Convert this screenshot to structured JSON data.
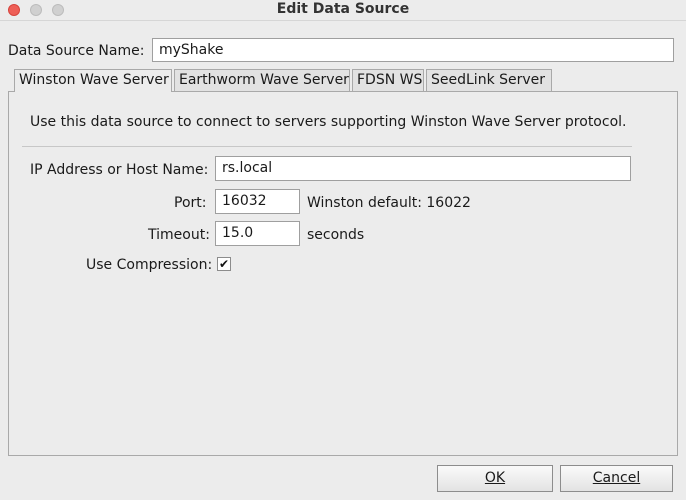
{
  "window": {
    "title": "Edit Data Source"
  },
  "data_source": {
    "name_label": "Data Source Name:",
    "name_value": "myShake"
  },
  "tabs": [
    {
      "label": "Winston Wave Server",
      "active": true
    },
    {
      "label": "Earthworm Wave Server",
      "active": false
    },
    {
      "label": "FDSN WS",
      "active": false
    },
    {
      "label": "SeedLink Server",
      "active": false
    }
  ],
  "panel": {
    "description": "Use this data source to connect to servers supporting Winston Wave Server protocol.",
    "host_label": "IP Address or Host Name:",
    "host_value": "rs.local",
    "port_label": "Port:",
    "port_value": "16032",
    "port_hint": "Winston default: 16022",
    "timeout_label": "Timeout:",
    "timeout_value": "15.0",
    "timeout_unit": "seconds",
    "compression_label": "Use Compression:",
    "compression_checked": true
  },
  "buttons": {
    "ok_label": "OK",
    "cancel_label": "Cancel"
  },
  "colors": {
    "close_button": "#ee5f57",
    "window_bg": "#ececec"
  }
}
